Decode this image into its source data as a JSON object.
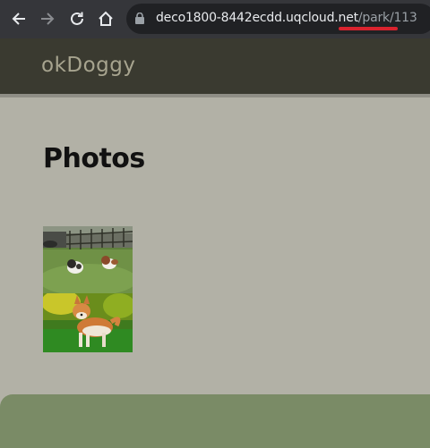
{
  "browser": {
    "url_host": "deco1800-8442ecdd.uqcloud.net",
    "url_path": "/park/113",
    "icons": [
      "back-icon",
      "forward-icon",
      "reload-icon",
      "home-icon",
      "lock-icon"
    ]
  },
  "header": {
    "logo": "okDoggy"
  },
  "main": {
    "title": "Photos",
    "photos": [
      {
        "name": "two small dogs on grass"
      },
      {
        "name": "shiba inu dog on grass"
      }
    ]
  },
  "colors": {
    "page_bg": "#b2b1a6",
    "header_bg": "#3a3a30",
    "footer_bg": "#7a8b66",
    "underline": "#d9232e"
  }
}
